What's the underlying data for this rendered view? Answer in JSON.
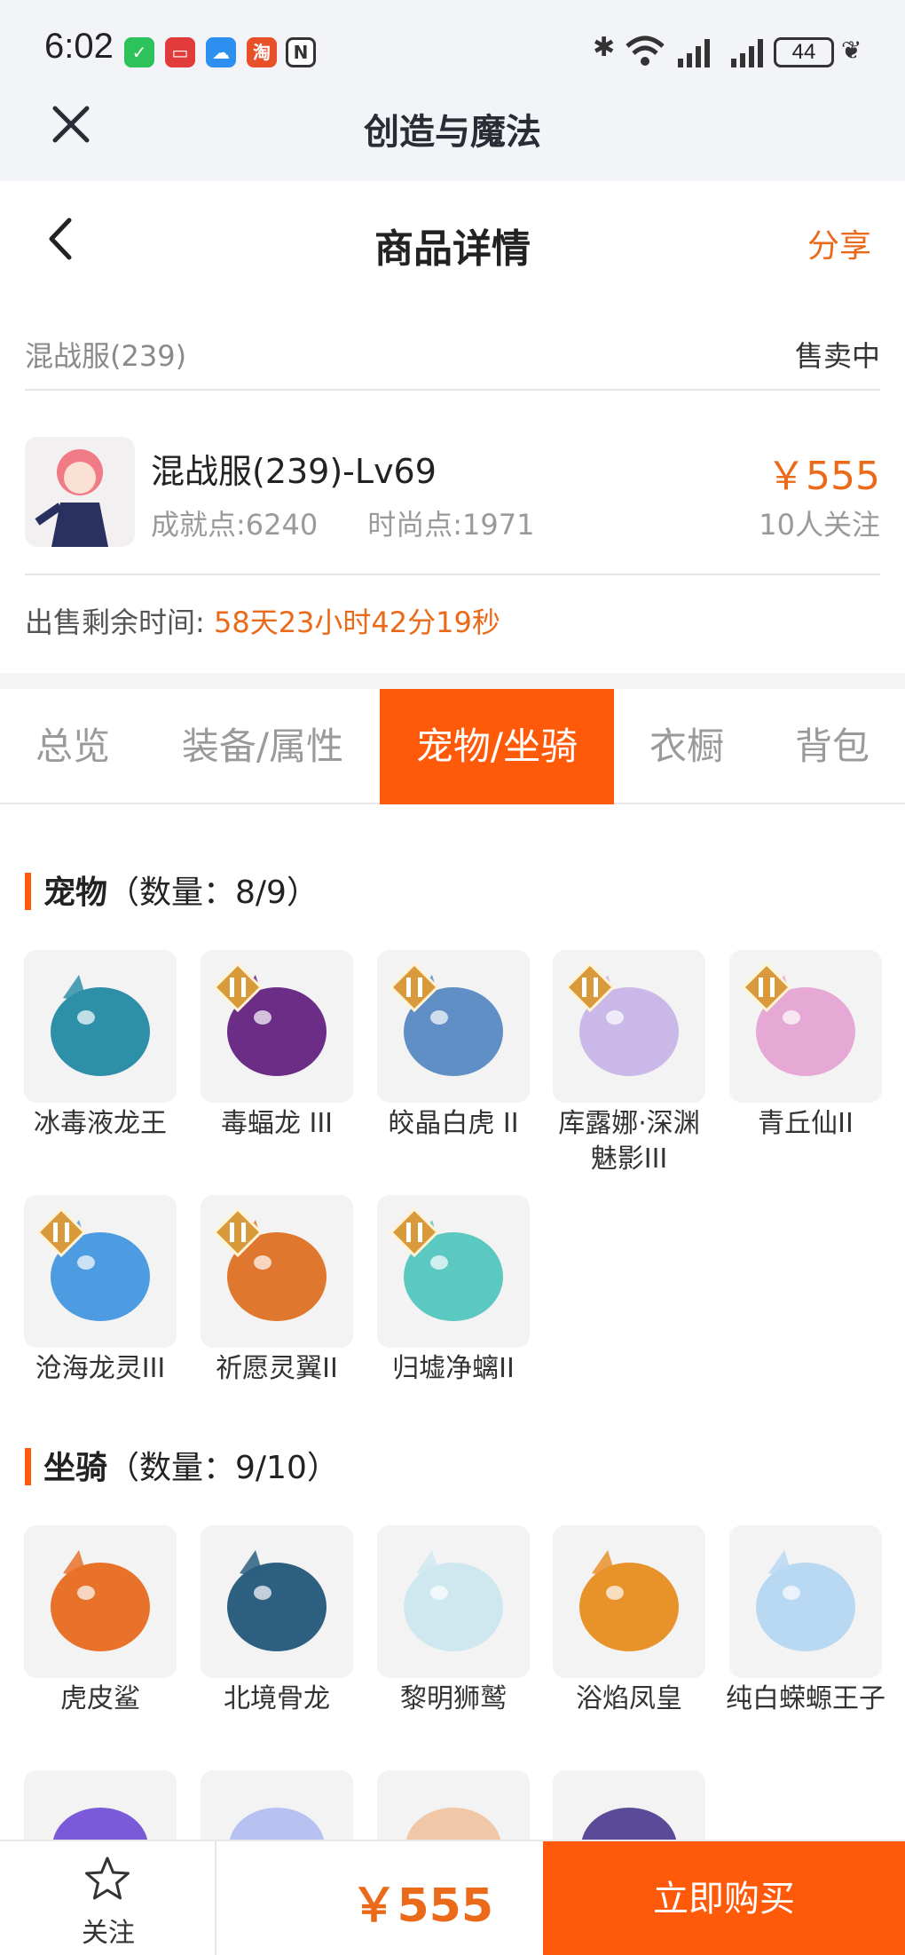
{
  "status_bar": {
    "time": "6:02",
    "battery": "44"
  },
  "app": {
    "title": "创造与魔法"
  },
  "page": {
    "title": "商品详情",
    "share_label": "分享"
  },
  "listing": {
    "server": "混战服(239)",
    "status": "售卖中",
    "title": "混战服(239)-Lv69",
    "achievement": "成就点:6240",
    "fashion": "时尚点:1971",
    "price": "￥555",
    "followers": "10人关注",
    "remaining_label": "出售剩余时间:",
    "remaining_value": "58天23小时42分19秒"
  },
  "tabs": [
    {
      "label": "总览",
      "active": false
    },
    {
      "label": "装备/属性",
      "active": false
    },
    {
      "label": "宠物/坐骑",
      "active": true
    },
    {
      "label": "衣橱",
      "active": false
    },
    {
      "label": "背包",
      "active": false
    }
  ],
  "pets": {
    "title": "宠物",
    "count": "（数量：8/9）",
    "items": [
      {
        "name": "冰毒液龙王",
        "color": "#2e8fa8"
      },
      {
        "name": "毒蝠龙 III",
        "color": "#6b2d86"
      },
      {
        "name": "皎晶白虎 II",
        "color": "#5f8fc4"
      },
      {
        "name": "库露娜·深渊魅影III",
        "color": "#c9b8e8"
      },
      {
        "name": "青丘仙II",
        "color": "#e6a8d4"
      },
      {
        "name": "沧海龙灵III",
        "color": "#4d9be0"
      },
      {
        "name": "祈愿灵翼II",
        "color": "#e0772e"
      },
      {
        "name": "归墟净螭II",
        "color": "#5cc8c2"
      }
    ]
  },
  "mounts": {
    "title": "坐骑",
    "count": "（数量：9/10）",
    "items": [
      {
        "name": "虎皮鲨",
        "color": "#e8722a"
      },
      {
        "name": "北境骨龙",
        "color": "#2c5f80"
      },
      {
        "name": "黎明狮鹫",
        "color": "#cfe8f0"
      },
      {
        "name": "浴焰凤皇",
        "color": "#e8922a"
      },
      {
        "name": "纯白蝾螈王子",
        "color": "#b9d8f2"
      }
    ]
  },
  "bottom": {
    "follow_label": "关注",
    "price": "￥555",
    "buy_label": "立即购买"
  }
}
